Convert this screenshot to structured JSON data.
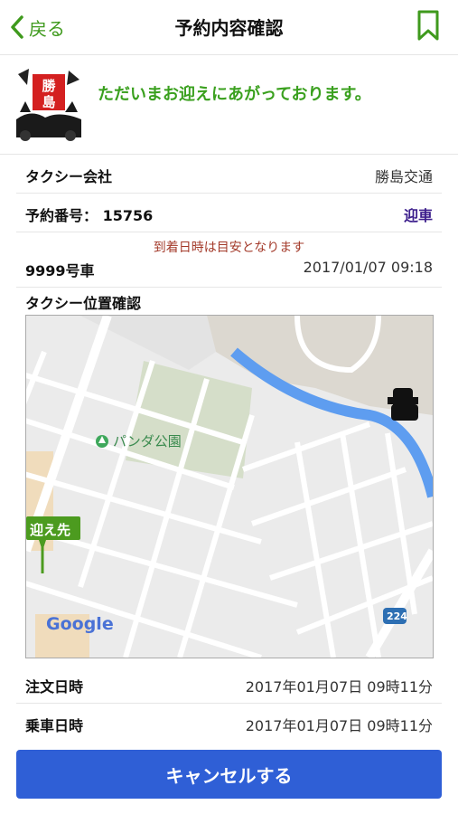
{
  "nav": {
    "back_label": "戻る",
    "title": "予約内容確認"
  },
  "status": {
    "message": "ただいまお迎えにあがっております。",
    "logo_text": "勝島"
  },
  "details": {
    "taxi_company_label": "タクシー会社",
    "taxi_company_value": "勝島交通",
    "reservation_number_label": "予約番号：",
    "reservation_number_value": "15756",
    "reservation_type": "迎車",
    "arrival_note": "到着日時は目安となります",
    "car_number": "9999号車",
    "arrival_datetime": "2017/01/07 09:18"
  },
  "map": {
    "section_title": "タクシー位置確認",
    "park_label": "パンダ公園",
    "pickup_label": "迎え先",
    "route_badge": "224",
    "google_label": "Google"
  },
  "order": {
    "order_datetime_label": "注文日時",
    "order_datetime_value": "2017年01月07日 09時11分",
    "ride_datetime_label": "乗車日時",
    "ride_datetime_value": "2017年01月07日 09時11分"
  },
  "actions": {
    "cancel_label": "キャンセルする"
  },
  "colors": {
    "accent_green": "#3aa01e",
    "cancel_blue": "#2f5fd6",
    "purple": "#3c1e8c",
    "note_red": "#a33a2a"
  }
}
